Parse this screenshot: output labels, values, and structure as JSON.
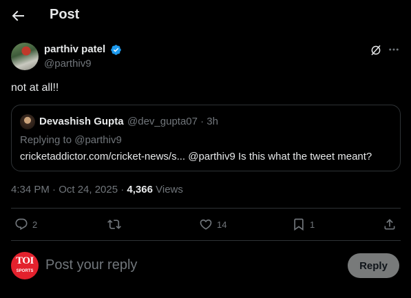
{
  "header": {
    "title": "Post"
  },
  "post": {
    "author_name": "parthiv patel",
    "author_handle": "@parthiv9",
    "text": "not at all!!",
    "timestamp": "4:34 PM · Oct 24, 2025 · ",
    "views_count": "4,366",
    "views_label": " Views"
  },
  "quote": {
    "author_name": "Devashish Gupta",
    "author_handle_time": "@dev_gupta07 · 3h",
    "replying_to": "Replying to @parthiv9",
    "text": "cricketaddictor.com/cricket-news/s... @parthiv9 Is this what the tweet meant?"
  },
  "actions": {
    "replies": "2",
    "reposts": "",
    "likes": "14",
    "bookmarks": "1"
  },
  "reply_box": {
    "placeholder": "Post your reply",
    "button_label": "Reply",
    "avatar_text": "TOI",
    "avatar_subtext": "SPORTS"
  },
  "colors": {
    "background": "#000000",
    "text": "#e7e9ea",
    "muted": "#71767b",
    "border": "#2f3336",
    "verified": "#1d9bf0",
    "reply_button": "#787a7a",
    "toi_red": "#e3212d"
  },
  "icons": [
    "back-arrow-icon",
    "verified-badge-icon",
    "grok-icon",
    "more-icon",
    "reply-icon",
    "repost-icon",
    "like-icon",
    "bookmark-icon",
    "share-icon"
  ]
}
